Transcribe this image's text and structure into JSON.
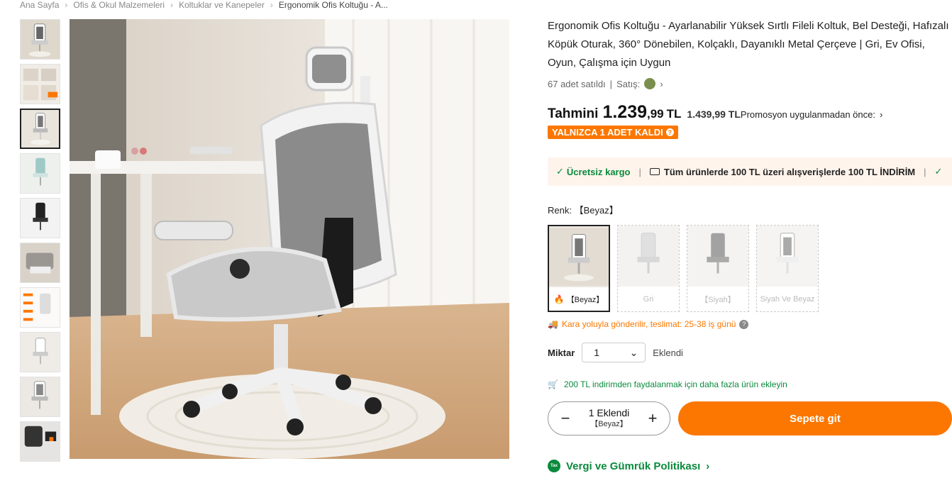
{
  "breadcrumb": {
    "items": [
      "Ana Sayfa",
      "Ofis & Okul Malzemeleri",
      "Koltuklar ve Kanepeler",
      "Ergonomik Ofis Koltuğu - A..."
    ]
  },
  "gallery": {
    "thumb_count": 10,
    "active_index": 2
  },
  "product": {
    "title": "Ergonomik Ofis Koltuğu - Ayarlanabilir Yüksek Sırtlı Fileli Koltuk, Bel Desteği, Hafızalı Köpük Oturak, 360° Dönebilen, Kolçaklı, Dayanıklı Metal Çerçeve | Gri, Ev Ofisi, Oyun, Çalışma için Uygun",
    "sold": "67 adet satıldı",
    "seller_label": "Satış:",
    "price_label": "Tahmini",
    "price_main": "1.239",
    "price_decimal": ",99",
    "price_currency": "TL",
    "old_price": "1.439,99 TL",
    "old_price_note": "Promosyon uygulanmadan önce:",
    "stock_badge": "YALNIZCA 1 ADET KALDI"
  },
  "promo": {
    "free_shipping": "Ücretsiz kargo",
    "deal": "Tüm ürünlerde 100 TL üzeri alışverişlerde 100 TL İNDİRİM"
  },
  "color": {
    "label": "Renk:",
    "selected": "【Beyaz】",
    "options": [
      "【Beyaz】",
      "Gri",
      "【Siyah】",
      "Siyah Ve Beyaz"
    ]
  },
  "shipping_note": "Kara yoluyla gönderilir, teslimat: 25-38 iş günü",
  "quantity": {
    "label": "Miktar",
    "value": "1",
    "added": "Eklendi"
  },
  "cart_hint": "200 TL indirimden faydalanmak için daha fazla ürün ekleyin",
  "stepper": {
    "line1": "1 Eklendi",
    "line2": "【Beyaz】"
  },
  "cart_button": "Sepete git",
  "tax": {
    "icon_text": "Tax",
    "title": "Vergi ve Gümrük Politikası"
  },
  "colors": {
    "accent": "#fb7701",
    "green": "#0a8a3c",
    "promo_bg": "#fff4ec"
  }
}
